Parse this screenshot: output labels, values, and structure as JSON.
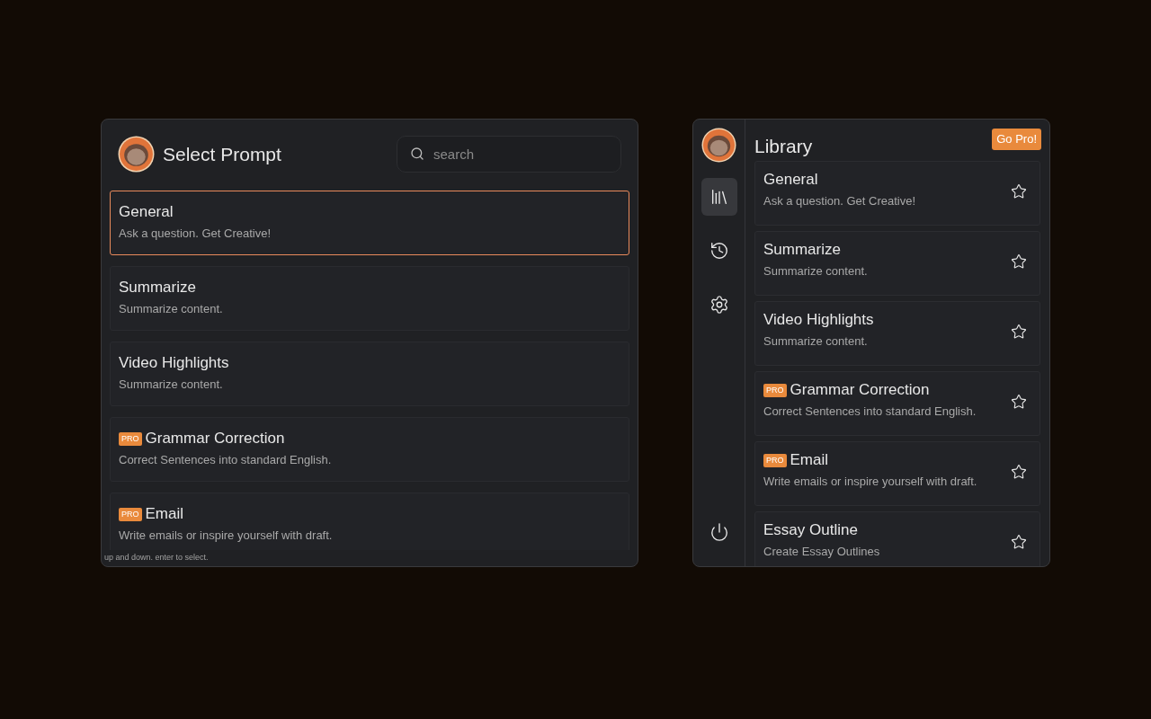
{
  "select_prompt": {
    "title": "Select Prompt",
    "search": {
      "placeholder": "search"
    },
    "items": [
      {
        "title": "General",
        "description": "Ask a question. Get Creative!",
        "selected": true
      },
      {
        "title": "Summarize",
        "description": "Summarize content.",
        "selected": false
      },
      {
        "title": "Video Highlights",
        "description": "Summarize content.",
        "selected": false
      },
      {
        "title": "Grammar Correction",
        "description": "Correct Sentences into standard English.",
        "badge": "PRO",
        "selected": false
      },
      {
        "title": "Email",
        "description": "Write emails or inspire yourself with draft.",
        "badge": "PRO",
        "selected": false
      }
    ],
    "hint": "up and down. enter to select."
  },
  "library": {
    "title": "Library",
    "go_pro": "Go Pro!",
    "nav": [
      {
        "kind": "library",
        "selected": true
      },
      {
        "kind": "history",
        "selected": false
      },
      {
        "kind": "settings",
        "selected": false
      }
    ],
    "items": [
      {
        "title": "General",
        "description": "Ask a question. Get Creative!",
        "starred": false
      },
      {
        "title": "Summarize",
        "description": "Summarize content.",
        "starred": false
      },
      {
        "title": "Video Highlights",
        "description": "Summarize content.",
        "starred": false
      },
      {
        "title": "Grammar Correction",
        "description": "Correct Sentences into standard English.",
        "badge": "PRO",
        "starred": false
      },
      {
        "title": "Email",
        "description": "Write emails or inspire yourself with draft.",
        "badge": "PRO",
        "starred": false
      },
      {
        "title": "Essay Outline",
        "description": "Create Essay Outlines",
        "starred": false
      }
    ]
  }
}
